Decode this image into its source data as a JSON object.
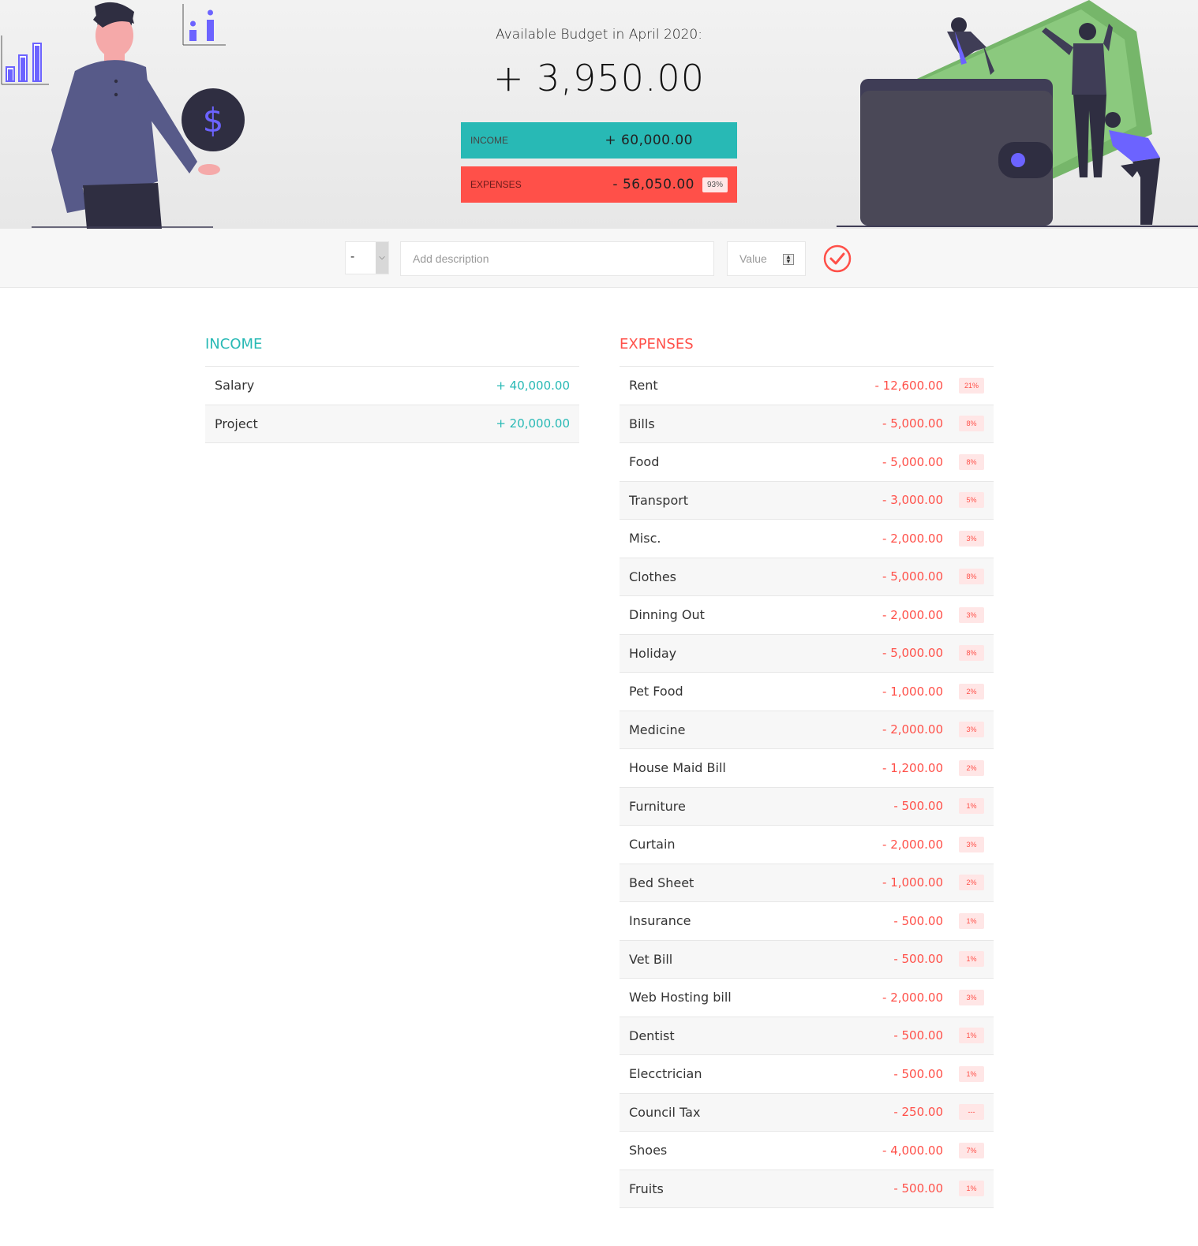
{
  "header": {
    "title": "Available Budget in April 2020:",
    "budget": "+ 3,950.00",
    "income": {
      "label": "Income",
      "value": "+ 60,000.00"
    },
    "expenses": {
      "label": "Expenses",
      "value": "- 56,050.00",
      "percentage": "93%"
    }
  },
  "add": {
    "type_value": "-",
    "description_placeholder": "Add description",
    "value_placeholder": "Value",
    "submit_icon": "checkmark-circle-icon"
  },
  "income": {
    "title": "Income",
    "items": [
      {
        "description": "Salary",
        "value": "+ 40,000.00"
      },
      {
        "description": "Project",
        "value": "+ 20,000.00"
      }
    ]
  },
  "expenses": {
    "title": "Expenses",
    "items": [
      {
        "description": "Rent",
        "value": "- 12,600.00",
        "percentage": "21%"
      },
      {
        "description": "Bills",
        "value": "- 5,000.00",
        "percentage": "8%"
      },
      {
        "description": "Food",
        "value": "- 5,000.00",
        "percentage": "8%"
      },
      {
        "description": "Transport",
        "value": "- 3,000.00",
        "percentage": "5%"
      },
      {
        "description": "Misc.",
        "value": "- 2,000.00",
        "percentage": "3%"
      },
      {
        "description": "Clothes",
        "value": "- 5,000.00",
        "percentage": "8%"
      },
      {
        "description": "Dinning Out",
        "value": "- 2,000.00",
        "percentage": "3%"
      },
      {
        "description": "Holiday",
        "value": "- 5,000.00",
        "percentage": "8%"
      },
      {
        "description": "Pet Food",
        "value": "- 1,000.00",
        "percentage": "2%"
      },
      {
        "description": "Medicine",
        "value": "- 2,000.00",
        "percentage": "3%"
      },
      {
        "description": "House Maid Bill",
        "value": "- 1,200.00",
        "percentage": "2%"
      },
      {
        "description": "Furniture",
        "value": "- 500.00",
        "percentage": "1%"
      },
      {
        "description": "Curtain",
        "value": "- 2,000.00",
        "percentage": "3%"
      },
      {
        "description": "Bed Sheet",
        "value": "- 1,000.00",
        "percentage": "2%"
      },
      {
        "description": "Insurance",
        "value": "- 500.00",
        "percentage": "1%"
      },
      {
        "description": "Vet Bill",
        "value": "- 500.00",
        "percentage": "1%"
      },
      {
        "description": "Web Hosting bill",
        "value": "- 2,000.00",
        "percentage": "3%"
      },
      {
        "description": "Dentist",
        "value": "- 500.00",
        "percentage": "1%"
      },
      {
        "description": "Elecctrician",
        "value": "- 500.00",
        "percentage": "1%"
      },
      {
        "description": "Council Tax",
        "value": "- 250.00",
        "percentage": "---"
      },
      {
        "description": "Shoes",
        "value": "- 4,000.00",
        "percentage": "7%"
      },
      {
        "description": "Fruits",
        "value": "- 500.00",
        "percentage": "1%"
      }
    ]
  },
  "colors": {
    "income": "#28b9b5",
    "expenses": "#ff5049",
    "accent_purple": "#6c63ff"
  }
}
